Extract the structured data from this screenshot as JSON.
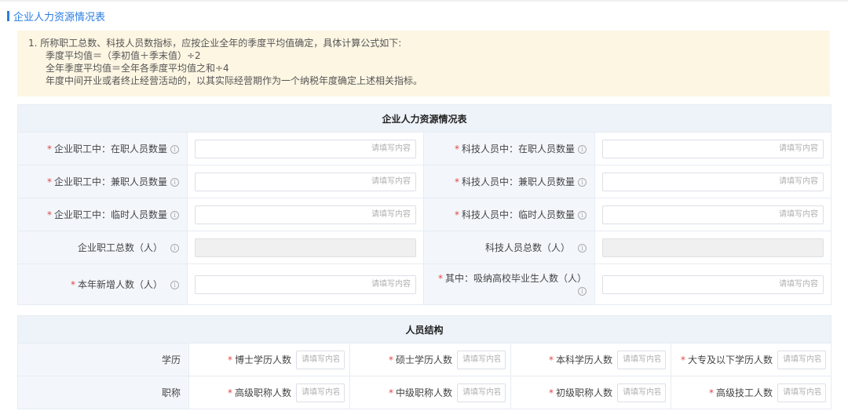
{
  "section_title": "企业人力资源情况表",
  "notice": {
    "line1": "1. 所称职工总数、科技人员数指标，应按企业全年的季度平均值确定，具体计算公式如下:",
    "line2": "季度平均值＝（季初值＋季末值）÷2",
    "line3": "全年季度平均值＝全年各季度平均值之和÷4",
    "line4": "年度中间开业或者终止经营活动的，以其实际经营期作为一个纳税年度确定上述相关指标。"
  },
  "hr_table": {
    "title": "企业人力资源情况表",
    "placeholder": "请填写内容",
    "rows": [
      {
        "left_label": "企业职工中：在职人员数量",
        "left_required": "*",
        "right_label": "科技人员中：在职人员数量",
        "right_required": "*"
      },
      {
        "left_label": "企业职工中：兼职人员数量",
        "left_required": "*",
        "right_label": "科技人员中：兼职人员数量",
        "right_required": "*"
      },
      {
        "left_label": "企业职工中：临时人员数量",
        "left_required": "*",
        "right_label": "科技人员中：临时人员数量",
        "right_required": "*"
      },
      {
        "left_label": "企业职工总数（人）",
        "left_required": "",
        "right_label": "科技人员总数（人）",
        "right_required": ""
      },
      {
        "left_label": "本年新增人数（人）",
        "left_required": "*",
        "right_label": "其中：吸纳高校毕业生人数（人）",
        "right_required": "*"
      }
    ]
  },
  "structure_table": {
    "title": "人员结构",
    "placeholder": "请填写内容",
    "education": {
      "label": "学历",
      "fields": [
        "博士学历人数",
        "硕士学历人数",
        "本科学历人数",
        "大专及以下学历人数"
      ]
    },
    "titles": {
      "label": "职称",
      "fields": [
        "高级职称人数",
        "中级职称人数",
        "初级职称人数",
        "高级技工人数"
      ]
    }
  },
  "icons": {
    "required_mark": "*",
    "info_icon": "i"
  },
  "colors": {
    "accent": "#2a7de1",
    "required": "#e54545",
    "notice_bg": "#fdf6e3",
    "header_bg": "#eef3f9"
  }
}
